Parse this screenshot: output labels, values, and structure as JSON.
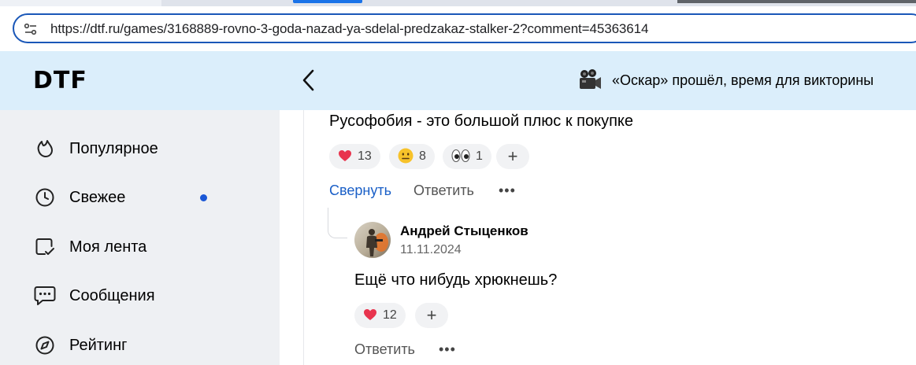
{
  "browser": {
    "url": "https://dtf.ru/games/3168889-rovno-3-goda-nazad-ya-sdelal-predzakaz-stalker-2?comment=45363614",
    "site_info_icon": "tune-icon"
  },
  "header": {
    "logo": "DTF",
    "back_icon": "chevron-left-icon",
    "promo": {
      "icon": "movie-camera-icon",
      "text": "«Оскар» прошёл, время для викторины"
    }
  },
  "sidebar": {
    "items": [
      {
        "label": "Популярное",
        "icon": "flame-icon"
      },
      {
        "label": "Свежее",
        "icon": "clock-icon",
        "has_new": true
      },
      {
        "label": "Моя лента",
        "icon": "feed-check-icon"
      },
      {
        "label": "Сообщения",
        "icon": "chat-bubble-icon"
      },
      {
        "label": "Рейтинг",
        "icon": "compass-icon"
      }
    ],
    "accent_color": "#1a57d6"
  },
  "comment": {
    "text": "Русофобия - это большой плюс к покупке",
    "reactions": [
      {
        "emoji": "❤️",
        "count": "13",
        "icon": "heart-icon"
      },
      {
        "emoji": "😐",
        "count": "8",
        "icon": "neutral-face-icon"
      },
      {
        "emoji": "👀",
        "count": "1",
        "icon": "eyes-icon"
      }
    ],
    "add_reaction": "+",
    "collapse_label": "Свернуть",
    "reply_label": "Ответить",
    "more_label": "•••"
  },
  "reply": {
    "author": "Андрей Стыценков",
    "date": "11.11.2024",
    "text": "Ещё что нибудь хрюкнешь?",
    "reactions": [
      {
        "emoji": "❤️",
        "count": "12",
        "icon": "heart-icon"
      }
    ],
    "add_reaction": "+",
    "reply_label": "Ответить",
    "more_label": "•••"
  },
  "colors": {
    "header_bg": "#dbeefb",
    "sidebar_bg": "#eef0f3",
    "link_blue": "#1a5fc7"
  }
}
